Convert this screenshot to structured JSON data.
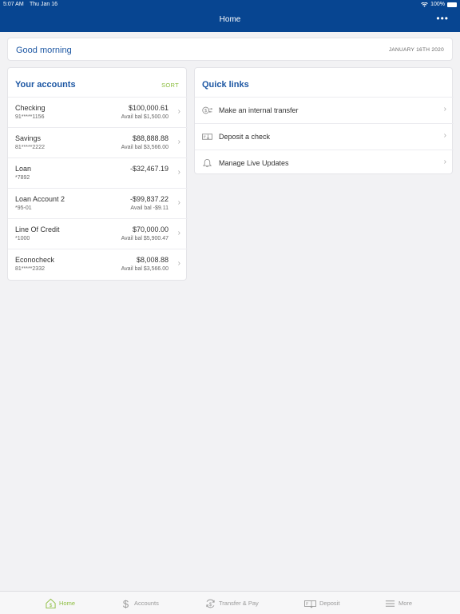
{
  "status": {
    "time": "5:07 AM",
    "date": "Thu Jan 16",
    "battery": "100%"
  },
  "nav": {
    "title": "Home",
    "more": "•••"
  },
  "greeting": {
    "text": "Good morning",
    "date": "JANUARY 16TH 2020"
  },
  "accounts": {
    "title": "Your accounts",
    "sort": "SORT",
    "items": [
      {
        "name": "Checking",
        "number": "91*****1156",
        "balance": "$100,000.61",
        "avail": "Avail bal $1,500.00"
      },
      {
        "name": "Savings",
        "number": "81*****2222",
        "balance": "$88,888.88",
        "avail": "Avail bal $3,566.00"
      },
      {
        "name": "Loan",
        "number": "*7892",
        "balance": "-$32,467.19",
        "avail": ""
      },
      {
        "name": "Loan Account 2",
        "number": "*95-01",
        "balance": "-$99,837.22",
        "avail": "Avail bal -$9.11"
      },
      {
        "name": "Line Of Credit",
        "number": "*1000",
        "balance": "$70,000.00",
        "avail": "Avail bal $5,900.47"
      },
      {
        "name": "Econocheck",
        "number": "81*****2332",
        "balance": "$8,008.88",
        "avail": "Avail bal $3,566.00"
      }
    ]
  },
  "quick_links": {
    "title": "Quick links",
    "items": [
      {
        "label": "Make an internal transfer",
        "icon": "transfer-icon"
      },
      {
        "label": "Deposit a check",
        "icon": "check-deposit-icon"
      },
      {
        "label": "Manage Live Updates",
        "icon": "bell-icon"
      }
    ]
  },
  "tabs": [
    {
      "label": "Home",
      "icon": "home-icon",
      "active": true
    },
    {
      "label": "Accounts",
      "icon": "dollar-icon",
      "active": false
    },
    {
      "label": "Transfer & Pay",
      "icon": "transfer-pay-icon",
      "active": false
    },
    {
      "label": "Deposit",
      "icon": "deposit-icon",
      "active": false
    },
    {
      "label": "More",
      "icon": "menu-icon",
      "active": false
    }
  ],
  "colors": {
    "header": "#074591",
    "accent": "#8cbd3f",
    "title": "#1d57a3"
  }
}
